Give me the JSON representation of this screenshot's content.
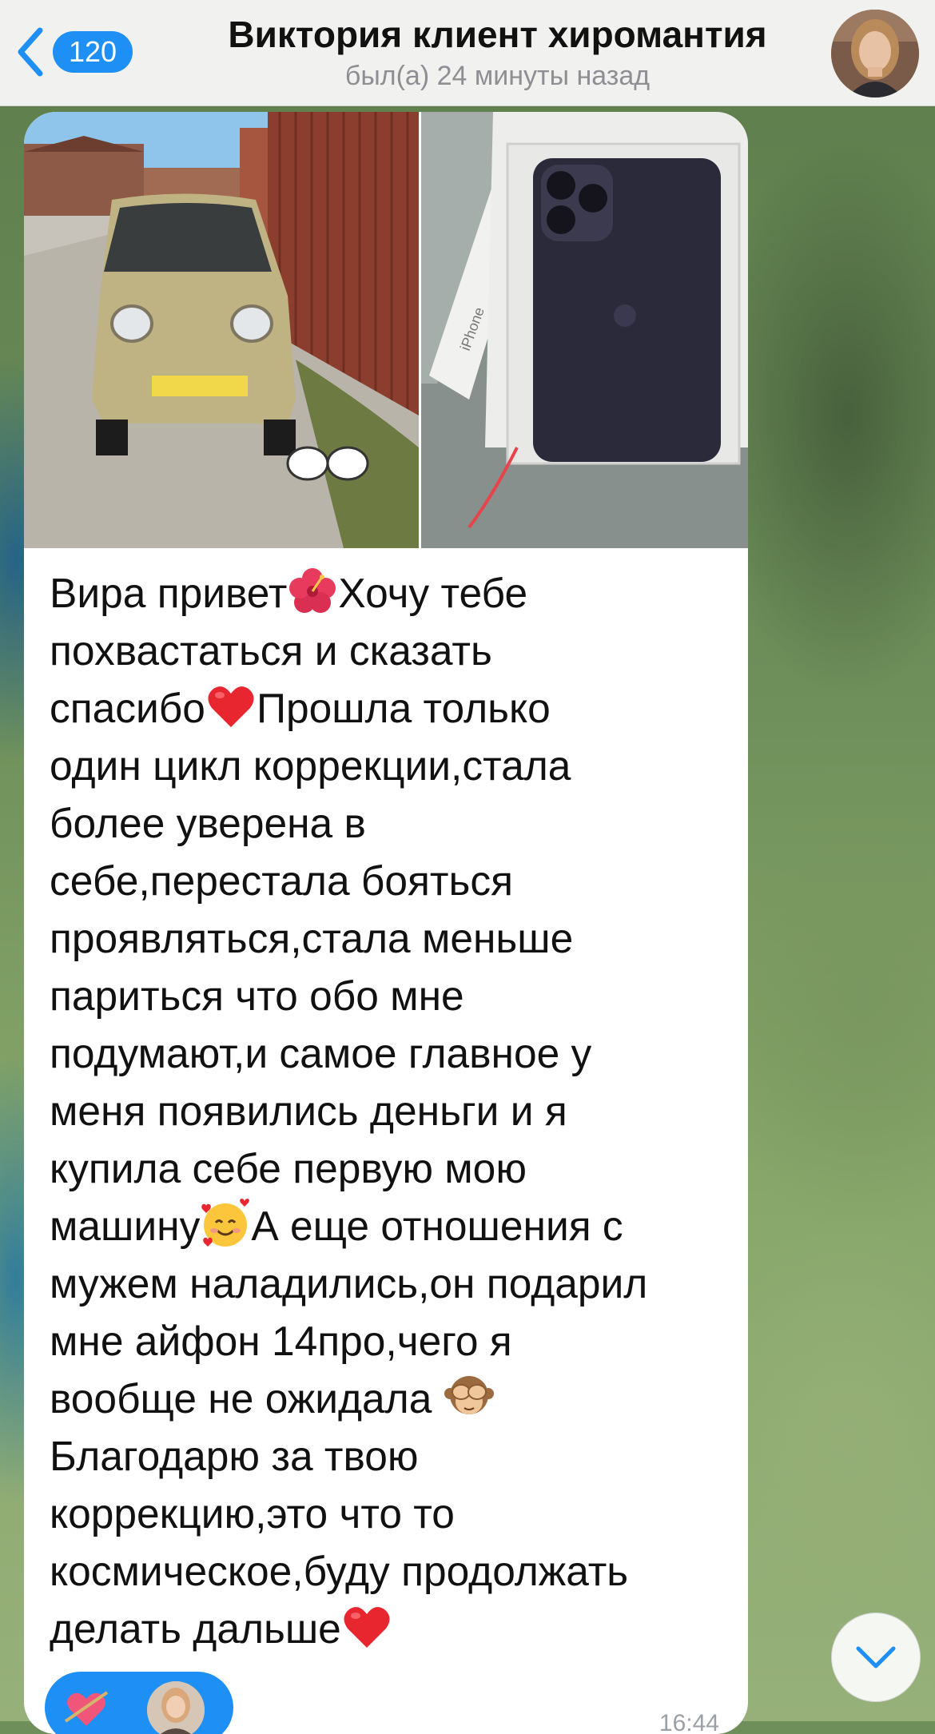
{
  "header": {
    "back_count": "120",
    "title": "Виктория клиент хиромантия",
    "status": "был(а) 24 минуты назад"
  },
  "message": {
    "photos": [
      {
        "name": "car-photo",
        "icon": "car-image"
      },
      {
        "name": "phone-photo",
        "icon": "smartphone-image",
        "box_text": "iPhone"
      }
    ],
    "text_lines": [
      {
        "parts": [
          "Вира привет",
          "hibiscus",
          "Хочу тебе"
        ]
      },
      {
        "parts": [
          "похвастаться и сказать"
        ]
      },
      {
        "parts": [
          "спасибо",
          "red-heart",
          "Прошла только"
        ]
      },
      {
        "parts": [
          "один цикл коррекции,стала"
        ]
      },
      {
        "parts": [
          "более уверена в"
        ]
      },
      {
        "parts": [
          "себе,перестала бояться"
        ]
      },
      {
        "parts": [
          "проявляться,стала меньше"
        ]
      },
      {
        "parts": [
          "париться что обо мне"
        ]
      },
      {
        "parts": [
          "подумают,и самое главное у"
        ]
      },
      {
        "parts": [
          "меня появились деньги и я"
        ]
      },
      {
        "parts": [
          "купила себе первую мою"
        ]
      },
      {
        "parts": [
          "машину",
          "smiling-face-with-hearts",
          "А еще отношения с"
        ]
      },
      {
        "parts": [
          "мужем наладились,он подарил"
        ]
      },
      {
        "parts": [
          "мне айфон 14про,чего я"
        ]
      },
      {
        "parts": [
          "вообще не ожидала ",
          "see-no-evil-monkey"
        ]
      },
      {
        "parts": [
          "Благодарю за твою"
        ]
      },
      {
        "parts": [
          "коррекцию,это что то"
        ]
      },
      {
        "parts": [
          "космическое,буду продолжать"
        ]
      },
      {
        "parts": [
          "делать дальше",
          "red-heart"
        ]
      }
    ],
    "time": "16:44",
    "reaction": {
      "emoji": "heart-with-arrow",
      "reactor": "avatar"
    }
  },
  "colors": {
    "accent": "#1e8ff5",
    "bubble": "#ffffff",
    "header_bg": "#f6f6f6",
    "status_text": "#8e8e93"
  },
  "icons": {
    "back": "chevron-left-icon",
    "scroll_down": "chevron-down-icon"
  }
}
